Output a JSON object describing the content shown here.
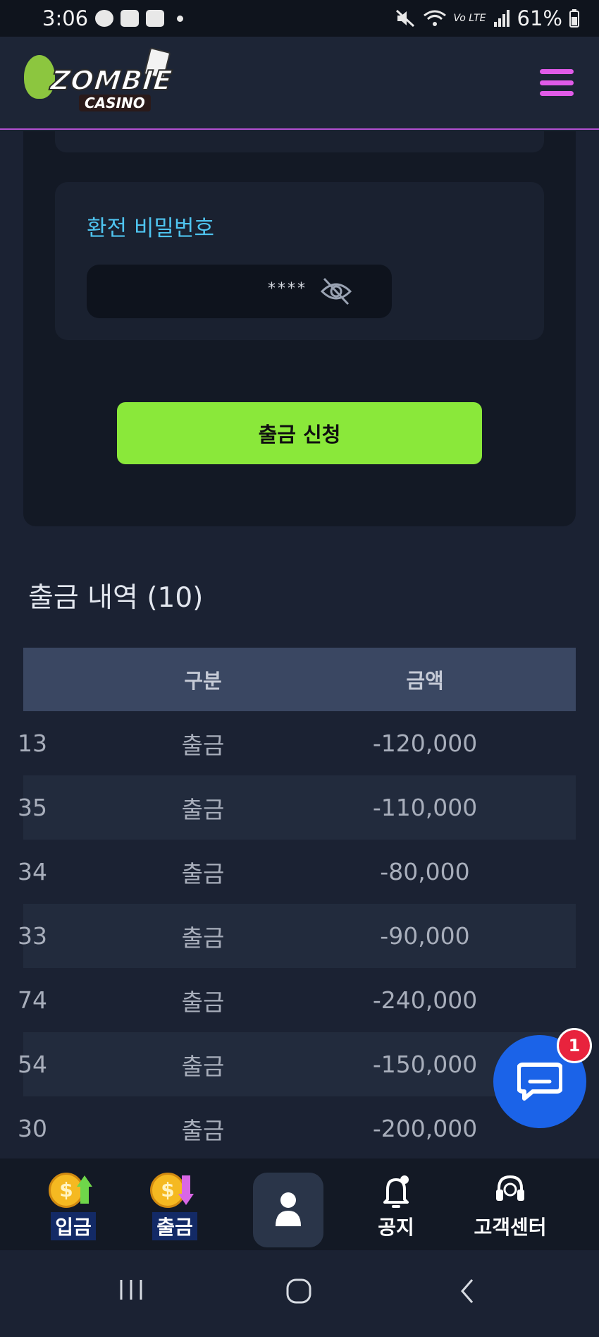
{
  "status_bar": {
    "time": "3:06",
    "battery": "61%",
    "network": "Vo LTE"
  },
  "header": {
    "logo_text": "ZOMBIE",
    "logo_subtext": "CASINO",
    "brand_color": "#8ae83a",
    "menu_color": "#e05be8"
  },
  "form": {
    "password_label": "환전 비밀번호",
    "password_value": "****",
    "submit_label": "출금 신청"
  },
  "history": {
    "title": "출금 내역 (10)",
    "columns": [
      "구분",
      "금액"
    ],
    "rows": [
      {
        "id": "13",
        "type": "출금",
        "amount": "-120,000"
      },
      {
        "id": "35",
        "type": "출금",
        "amount": "-110,000"
      },
      {
        "id": "34",
        "type": "출금",
        "amount": "-80,000"
      },
      {
        "id": "33",
        "type": "출금",
        "amount": "-90,000"
      },
      {
        "id": "74",
        "type": "출금",
        "amount": "-240,000"
      },
      {
        "id": "54",
        "type": "출금",
        "amount": "-150,000"
      },
      {
        "id": "30",
        "type": "출금",
        "amount": "-200,000"
      }
    ]
  },
  "chat": {
    "badge_count": "1"
  },
  "bottom_nav": {
    "deposit": "입금",
    "withdraw": "출금",
    "notice": "공지",
    "support": "고객센터"
  }
}
